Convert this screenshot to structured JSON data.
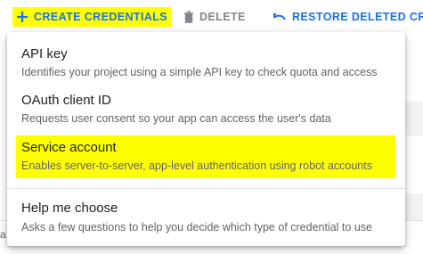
{
  "toolbar": {
    "create_label": "CREATE CREDENTIALS",
    "delete_label": "DELETE",
    "restore_label": "RESTORE DELETED CRED"
  },
  "menu": {
    "items": [
      {
        "title": "API key",
        "description": "Identifies your project using a simple API key to check quota and access"
      },
      {
        "title": "OAuth client ID",
        "description": "Requests user consent so your app can access the user's data"
      },
      {
        "title": "Service account",
        "description": "Enables server-to-server, app-level authentication using robot accounts"
      },
      {
        "title": "Help me choose",
        "description": "Asks a few questions to help you decide which type of credential to use"
      }
    ]
  },
  "background": {
    "partial_letter": "a"
  },
  "colors": {
    "accent": "#1a73e8",
    "highlight": "#ffff00",
    "disabled": "#80868b",
    "secondary_text": "#5f6368"
  },
  "icons": {
    "create": "plus-icon",
    "delete": "trash-icon",
    "restore": "undo-icon"
  }
}
